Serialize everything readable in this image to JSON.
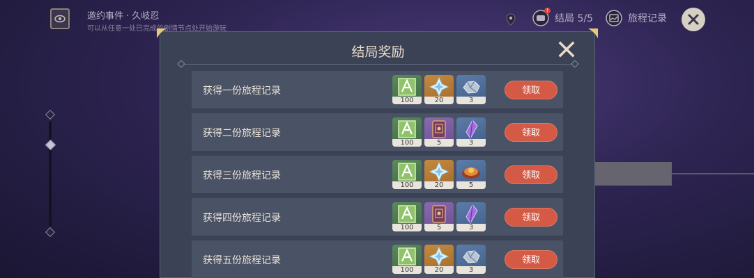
{
  "topbar": {
    "event_title": "邀约事件 · 久岐忍",
    "event_subtitle": "可以从任意一处已完成的剧情节点处开始游玩",
    "ending_label": "结局 5/5",
    "ending_badge": "!",
    "record_label": "旅程记录"
  },
  "panel": {
    "title": "结局奖励",
    "rows": [
      {
        "label": "获得一份旅程记录",
        "button": "领取",
        "items": [
          {
            "icon": "hero-wit-icon",
            "quality": "green",
            "count": "100"
          },
          {
            "icon": "primogem-icon",
            "quality": "orange",
            "count": "20"
          },
          {
            "icon": "mystic-ore-icon",
            "quality": "blue",
            "count": "3"
          }
        ]
      },
      {
        "label": "获得二份旅程记录",
        "button": "领取",
        "items": [
          {
            "icon": "hero-wit-icon",
            "quality": "green",
            "count": "100"
          },
          {
            "icon": "talent-book-icon",
            "quality": "purple",
            "count": "5"
          },
          {
            "icon": "amethyst-crystal-icon",
            "quality": "blue",
            "count": "3"
          }
        ]
      },
      {
        "label": "获得三份旅程记录",
        "button": "领取",
        "items": [
          {
            "icon": "hero-wit-icon",
            "quality": "green",
            "count": "100"
          },
          {
            "icon": "primogem-icon",
            "quality": "orange",
            "count": "20"
          },
          {
            "icon": "dish-icon",
            "quality": "blue",
            "count": "5"
          }
        ]
      },
      {
        "label": "获得四份旅程记录",
        "button": "领取",
        "items": [
          {
            "icon": "hero-wit-icon",
            "quality": "green",
            "count": "100"
          },
          {
            "icon": "talent-book-icon",
            "quality": "purple",
            "count": "5"
          },
          {
            "icon": "amethyst-crystal-icon",
            "quality": "blue",
            "count": "3"
          }
        ]
      },
      {
        "label": "获得五份旅程记录",
        "button": "领取",
        "items": [
          {
            "icon": "hero-wit-icon",
            "quality": "green",
            "count": "100"
          },
          {
            "icon": "primogem-icon",
            "quality": "orange",
            "count": "20"
          },
          {
            "icon": "mystic-ore-icon",
            "quality": "blue",
            "count": "3"
          }
        ]
      }
    ]
  },
  "colors": {
    "claim_button": "#d45a46",
    "panel_bg": "#3b4255",
    "row_bg": "#4a5266"
  }
}
